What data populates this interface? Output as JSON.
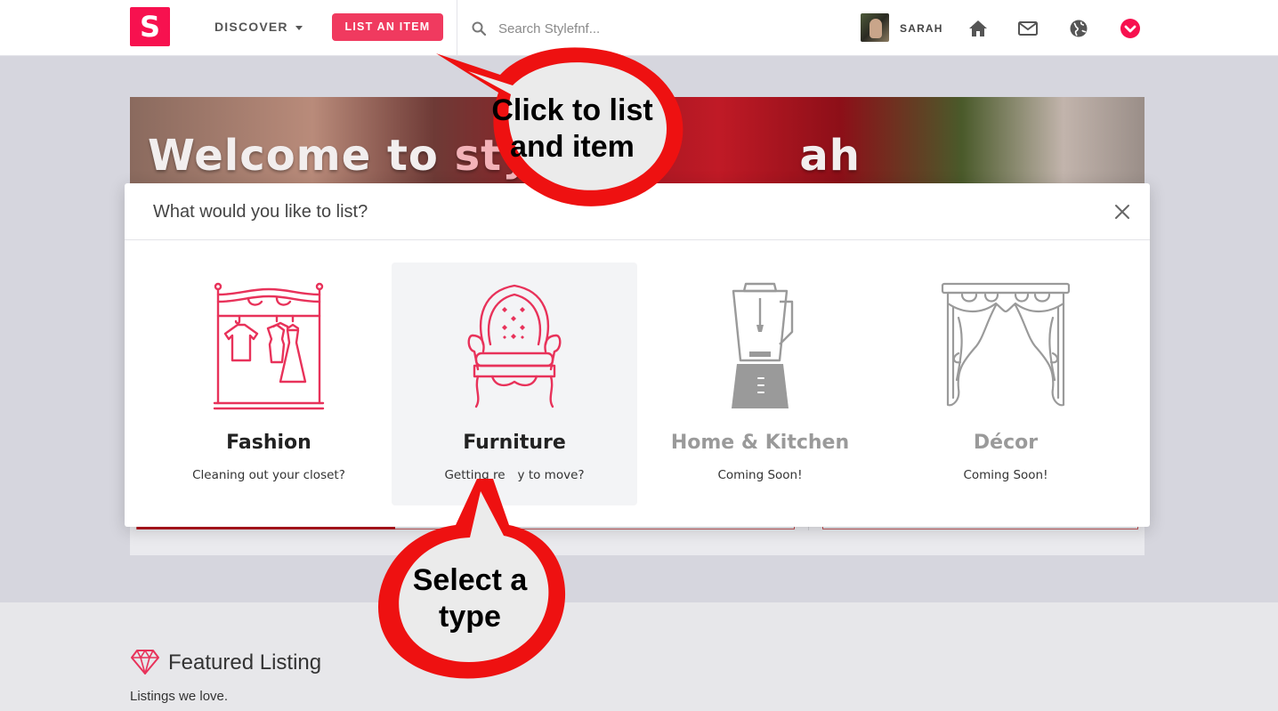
{
  "nav": {
    "logo_letter": "S",
    "discover_label": "DISCOVER",
    "list_button_label": "LIST AN ITEM",
    "search_placeholder": "Search Stylefnf...",
    "username": "SARAH",
    "icons": [
      "search-icon",
      "home-icon",
      "mail-icon",
      "globe-icon",
      "chevron-down-circle-icon"
    ],
    "accent_color": "#f03a5f"
  },
  "hero": {
    "title_part1": "Welcome to ",
    "title_part2": "sty",
    "title_part3": "ah"
  },
  "modal": {
    "title": "What would you like to list?",
    "options": [
      {
        "label": "Fashion",
        "description": "Cleaning out your closet?",
        "icon": "clothes-rack-icon",
        "enabled": true
      },
      {
        "label": "Furniture",
        "description": "Getting re",
        "description_tail": "y to move?",
        "icon": "armchair-icon",
        "enabled": true
      },
      {
        "label": "Home & Kitchen",
        "description": "Coming Soon!",
        "icon": "blender-icon",
        "enabled": false
      },
      {
        "label": "Décor",
        "description": "Coming Soon!",
        "icon": "curtains-icon",
        "enabled": false
      }
    ]
  },
  "annotations": {
    "callout_top_line1": "Click to list",
    "callout_top_line2": "and item",
    "callout_bottom_line1": "Select a",
    "callout_bottom_line2": "type",
    "callout_color": "#ee1111"
  },
  "featured": {
    "title": "Featured Listing",
    "subtitle": "Listings we love."
  }
}
